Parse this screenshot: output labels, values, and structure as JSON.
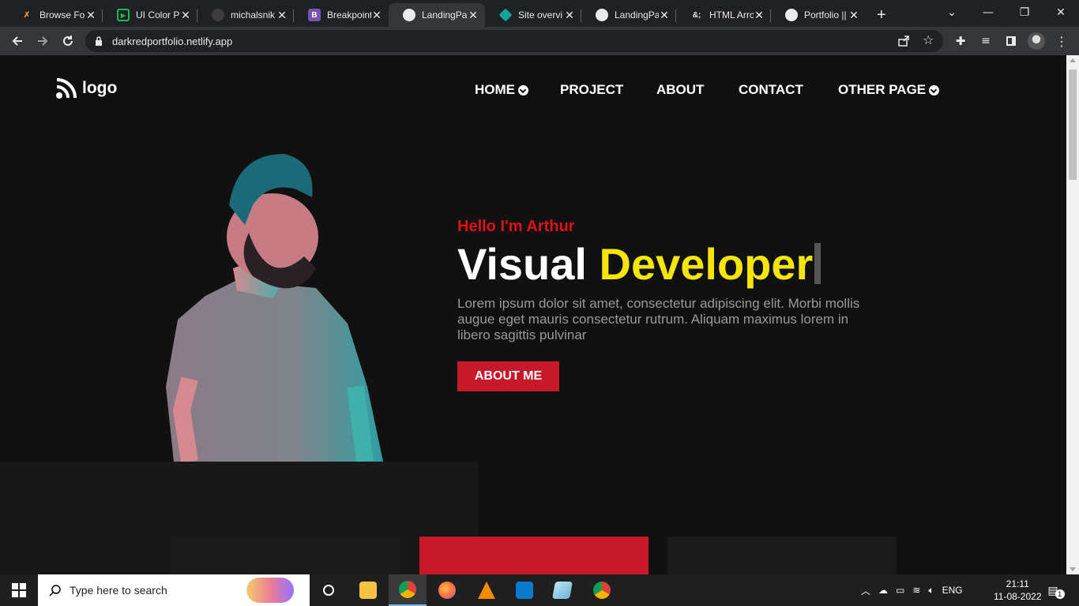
{
  "browser": {
    "tabs": [
      {
        "title": "Browse For",
        "fav_color": "#ffffff",
        "fav_text": "",
        "active": false
      },
      {
        "title": "UI Color Pi",
        "fav_color": "#1db954",
        "fav_text": "",
        "active": false
      },
      {
        "title": "michalsnik",
        "fav_color": "#24292f",
        "fav_text": "",
        "active": false
      },
      {
        "title": "Breakpoint",
        "fav_color": "#7952b3",
        "fav_text": "B",
        "active": false
      },
      {
        "title": "LandingPa",
        "fav_color": "#e8eaed",
        "fav_text": "",
        "active": true
      },
      {
        "title": "Site overvi",
        "fav_color": "#15a397",
        "fav_text": "",
        "active": false
      },
      {
        "title": "LandingPa",
        "fav_color": "#e8eaed",
        "fav_text": "",
        "active": false
      },
      {
        "title": "HTML Arro",
        "fav_color": "#202124",
        "fav_text": "&;",
        "active": false
      },
      {
        "title": "Portfolio ||",
        "fav_color": "#e8eaed",
        "fav_text": "",
        "active": false
      }
    ],
    "url": "darkredportfolio.netlify.app"
  },
  "site": {
    "logo_text": "logo",
    "nav": [
      {
        "label": "HOME",
        "dropdown": true
      },
      {
        "label": "PROJECT",
        "dropdown": false
      },
      {
        "label": "ABOUT",
        "dropdown": false
      },
      {
        "label": "CONTACT",
        "dropdown": false
      },
      {
        "label": "OTHER PAGE",
        "dropdown": true
      }
    ],
    "hero": {
      "greeting": "Hello I'm Arthur",
      "title_plain": "Visual ",
      "title_highlight": "Developer",
      "description": "Lorem ipsum dolor sit amet, consectetur adipiscing elit. Morbi mollis augue eget mauris consectetur rutrum. Aliquam maximus lorem in libero sagittis pulvinar",
      "button_label": "ABOUT ME"
    },
    "colors": {
      "accent": "#c8192a",
      "greeting": "#e0111a",
      "highlight": "#f5e50a",
      "background": "#111111"
    }
  },
  "taskbar": {
    "search_placeholder": "Type here to search",
    "language": "ENG",
    "time": "21:11",
    "date": "11-08-2022",
    "notification_count": "1"
  }
}
